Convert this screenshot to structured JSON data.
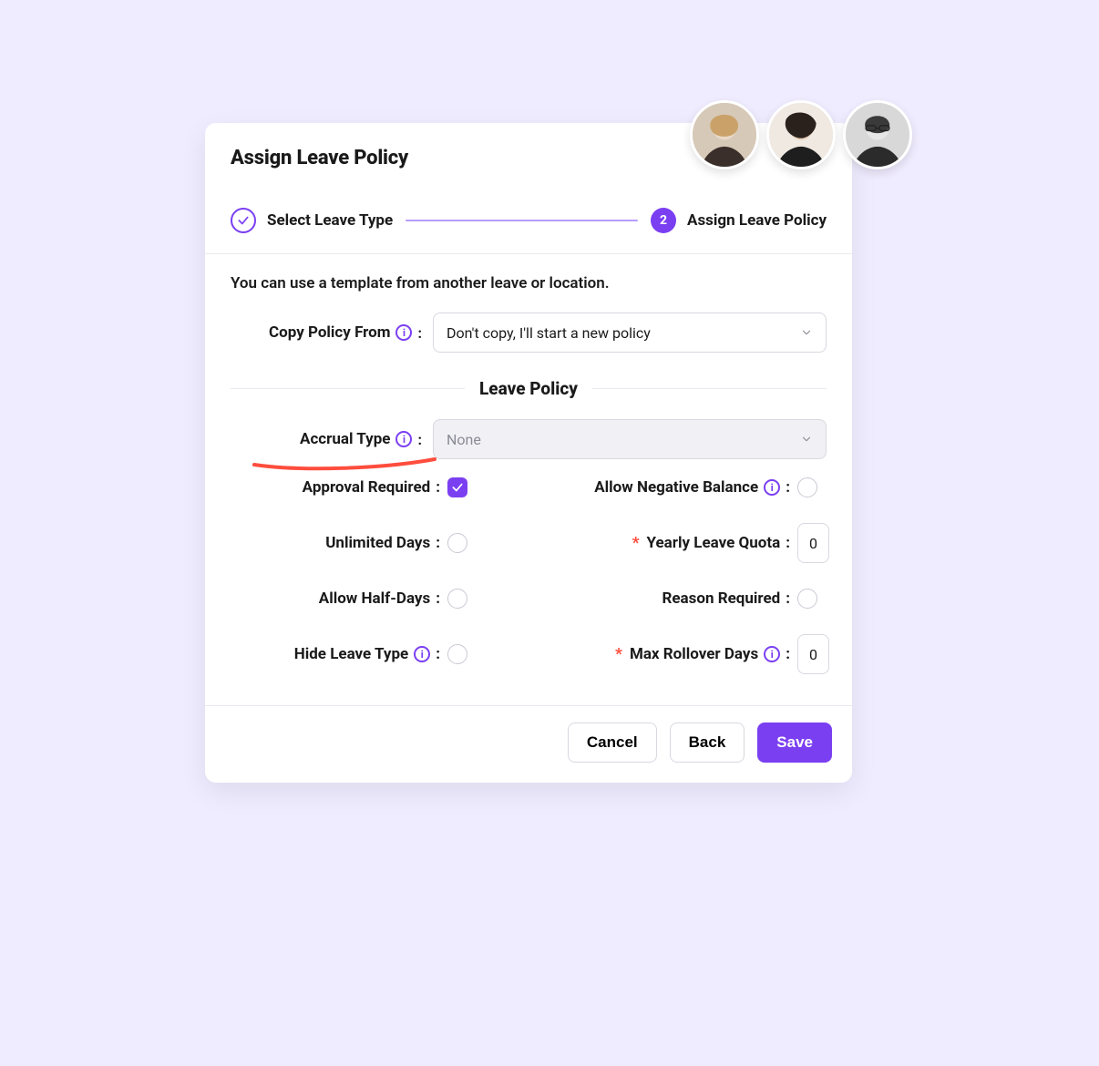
{
  "header": {
    "title": "Assign Leave Policy"
  },
  "stepper": {
    "step1": {
      "label": "Select Leave Type"
    },
    "step2": {
      "number": "2",
      "label": "Assign Leave Policy"
    }
  },
  "body": {
    "help_text": "You can use a template from another leave or location.",
    "copy_label": "Copy Policy From",
    "colon": ":",
    "copy_value": "Don't copy, I'll start a new policy",
    "section_title": "Leave Policy",
    "accrual_label": "Accrual Type",
    "accrual_value": "None",
    "fields": {
      "approval_required": "Approval Required",
      "allow_negative": "Allow Negative Balance",
      "unlimited_days": "Unlimited Days",
      "yearly_quota": "Yearly Leave Quota",
      "yearly_quota_value": "0",
      "allow_half_days": "Allow Half-Days",
      "reason_required": "Reason Required",
      "hide_leave_type": "Hide Leave Type",
      "max_rollover": "Max Rollover Days",
      "max_rollover_value": "0"
    }
  },
  "footer": {
    "cancel": "Cancel",
    "back": "Back",
    "save": "Save"
  },
  "colors": {
    "accent": "#7b3ff2",
    "highlight": "#ff4d3d"
  }
}
